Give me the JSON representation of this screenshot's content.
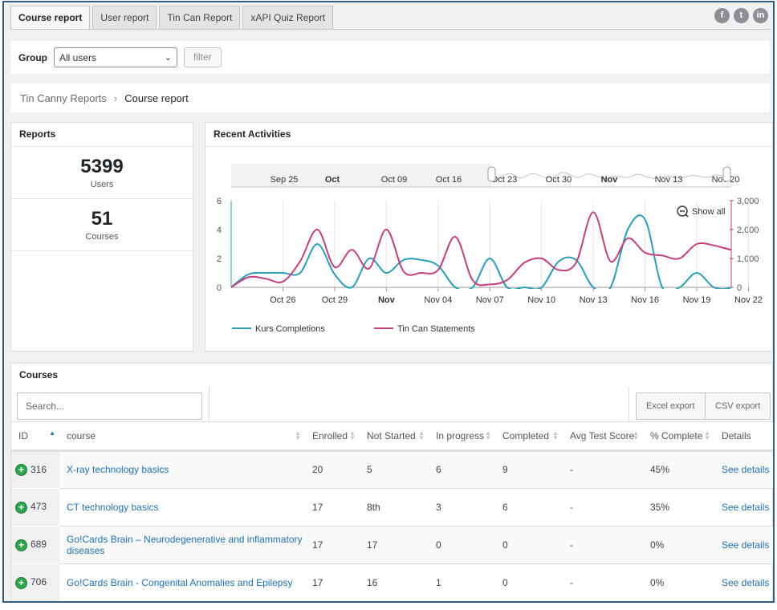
{
  "tabs": [
    "Course report",
    "User report",
    "Tin Can Report",
    "xAPI Quiz Report"
  ],
  "social": [
    {
      "icon": "facebook-icon",
      "glyph": "f"
    },
    {
      "icon": "twitter-icon",
      "glyph": "t"
    },
    {
      "icon": "linkedin-icon",
      "glyph": "in"
    }
  ],
  "filter": {
    "label": "Group",
    "selected": "All users",
    "button": "filter"
  },
  "breadcrumb": {
    "root": "Tin Canny Reports",
    "separator": "›",
    "current": "Course report"
  },
  "reports": {
    "title": "Reports",
    "users": {
      "value": "5399",
      "label": "Users"
    },
    "courses": {
      "value": "51",
      "label": "Courses"
    }
  },
  "activities": {
    "title": "Recent Activities",
    "show_all": "Show all",
    "navigator_labels": [
      "Sep 25",
      "Oct",
      "Oct 09",
      "Oct 16",
      "Oct 23",
      "Oct 30",
      "Nov",
      "Nov 13",
      "Nov 20"
    ],
    "navigator_bold": [
      "Oct",
      "Nov"
    ]
  },
  "chart_data": {
    "type": "line",
    "categories": [
      "Oct 26",
      "Oct 29",
      "Nov",
      "Nov 04",
      "Nov 07",
      "Nov 10",
      "Nov 13",
      "Nov 16",
      "Nov 19",
      "Nov 22"
    ],
    "bold_categories": [
      "Nov"
    ],
    "left_axis": {
      "ticks": [
        "0",
        "2",
        "4",
        "6"
      ],
      "range": [
        0,
        6
      ]
    },
    "right_axis": {
      "ticks": [
        "0",
        "1,000",
        "2,000",
        "3,000"
      ],
      "range": [
        0,
        3000
      ]
    },
    "x_range": [
      23,
      52
    ],
    "series": [
      {
        "name": "Kurs Completions",
        "axis": "left",
        "color": "#2a9db8",
        "points": [
          [
            23,
            0
          ],
          [
            24,
            0.9
          ],
          [
            25,
            1
          ],
          [
            26,
            1
          ],
          [
            27,
            1
          ],
          [
            28,
            3
          ],
          [
            29,
            0.9
          ],
          [
            30,
            0
          ],
          [
            31,
            2
          ],
          [
            32,
            1
          ],
          [
            33,
            1.9
          ],
          [
            34,
            1.9
          ],
          [
            35,
            1.5
          ],
          [
            36,
            0
          ],
          [
            37,
            0
          ],
          [
            38,
            2
          ],
          [
            39,
            0
          ],
          [
            40,
            0
          ],
          [
            41,
            0
          ],
          [
            42,
            1.8
          ],
          [
            43,
            1.9
          ],
          [
            44,
            0
          ],
          [
            45,
            0
          ],
          [
            46,
            4
          ],
          [
            47,
            4.7
          ],
          [
            48,
            0
          ],
          [
            49,
            0
          ],
          [
            50,
            1
          ],
          [
            51,
            0
          ],
          [
            52,
            0
          ],
          [
            53,
            1
          ],
          [
            54,
            0
          ],
          [
            55,
            0.6
          ]
        ]
      },
      {
        "name": "Tin Can Statements",
        "axis": "right",
        "color": "#c2417d",
        "points": [
          [
            23,
            0
          ],
          [
            24,
            350
          ],
          [
            25,
            300
          ],
          [
            26,
            200
          ],
          [
            27,
            900
          ],
          [
            28,
            2000
          ],
          [
            29,
            700
          ],
          [
            30,
            1300
          ],
          [
            31,
            650
          ],
          [
            32,
            2000
          ],
          [
            33,
            550
          ],
          [
            34,
            500
          ],
          [
            35,
            600
          ],
          [
            36,
            1750
          ],
          [
            37,
            250
          ],
          [
            38,
            100
          ],
          [
            39,
            250
          ],
          [
            40,
            850
          ],
          [
            41,
            1000
          ],
          [
            42,
            600
          ],
          [
            43,
            850
          ],
          [
            44,
            2600
          ],
          [
            45,
            900
          ],
          [
            46,
            1700
          ],
          [
            47,
            1200
          ],
          [
            48,
            1100
          ],
          [
            49,
            1000
          ],
          [
            50,
            1500
          ],
          [
            51,
            1450
          ],
          [
            52,
            1300
          ],
          [
            53,
            1250
          ],
          [
            54,
            1000
          ]
        ]
      }
    ]
  },
  "courses": {
    "title": "Courses",
    "search_placeholder": "Search...",
    "excel_export": "Excel export",
    "csv_export": "CSV export",
    "columns": [
      "ID",
      "course",
      "Enrolled",
      "Not Started",
      "In progress",
      "Completed",
      "Avg Test Score",
      "% Complete",
      "Details"
    ],
    "rows": [
      {
        "id": "316",
        "course": "X-ray technology basics",
        "enrolled": "20",
        "not_started": "5",
        "in_progress": "6",
        "completed": "9",
        "avg": "-",
        "pct": "45%",
        "details": "See details"
      },
      {
        "id": "473",
        "course": "CT technology basics",
        "enrolled": "17",
        "not_started": "8th",
        "in_progress": "3",
        "completed": "6",
        "avg": "-",
        "pct": "35%",
        "details": "See details"
      },
      {
        "id": "689",
        "course": "Go!Cards Brain – Neurodegenerative and inflammatory diseases",
        "enrolled": "17",
        "not_started": "17",
        "in_progress": "0",
        "completed": "0",
        "avg": "-",
        "pct": "0%",
        "details": "See details"
      },
      {
        "id": "706",
        "course": "Go!Cards Brain - Congenital Anomalies and Epilepsy",
        "enrolled": "17",
        "not_started": "16",
        "in_progress": "1",
        "completed": "0",
        "avg": "-",
        "pct": "0%",
        "details": "See details"
      }
    ]
  }
}
